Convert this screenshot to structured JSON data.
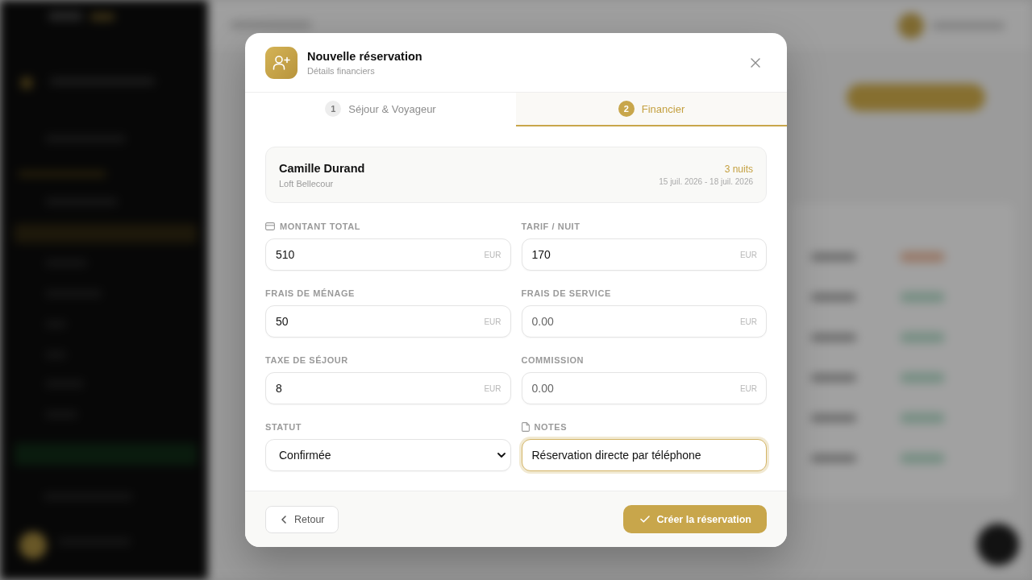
{
  "dialog": {
    "title": "Nouvelle réservation",
    "subtitle": "Détails financiers"
  },
  "steps": [
    {
      "number": "1",
      "label": "Séjour & Voyageur",
      "selected": false
    },
    {
      "number": "2",
      "label": "Financier",
      "selected": true
    }
  ],
  "summary": {
    "guest": "Camille Durand",
    "property": "Loft Bellecour",
    "nights": "3 nuits",
    "dates": "15 juil. 2026 - 18 juil. 2026"
  },
  "fields": [
    {
      "kind": "money",
      "label": "MONTANT TOTAL",
      "icon": true,
      "value": "510",
      "unit": "EUR",
      "focused": false
    },
    {
      "kind": "money",
      "label": "TARIF / NUIT",
      "icon": false,
      "value": "170",
      "unit": "EUR",
      "focused": false
    },
    {
      "kind": "money",
      "label": "FRAIS DE MÉNAGE",
      "icon": false,
      "value": "50",
      "unit": "EUR",
      "focused": false
    },
    {
      "kind": "money",
      "label": "FRAIS DE SERVICE",
      "icon": false,
      "placeholder": "0.00",
      "unit": "EUR",
      "focused": false
    },
    {
      "kind": "money",
      "label": "TAXE DE SÉJOUR",
      "icon": false,
      "value": "8",
      "unit": "EUR",
      "focused": false
    },
    {
      "kind": "money",
      "label": "COMMISSION",
      "icon": false,
      "placeholder": "0.00",
      "unit": "EUR",
      "focused": false
    },
    {
      "kind": "select",
      "label": "STATUT",
      "icon": false,
      "value": "Confirmée",
      "focused": false
    },
    {
      "kind": "text",
      "label": "NOTES",
      "icon": true,
      "value": "Réservation directe par téléphone",
      "focused": true
    }
  ],
  "buttons": [
    {
      "kind": "back",
      "label": "Retour"
    },
    {
      "kind": "primary",
      "label": "Créer la réservation"
    }
  ]
}
